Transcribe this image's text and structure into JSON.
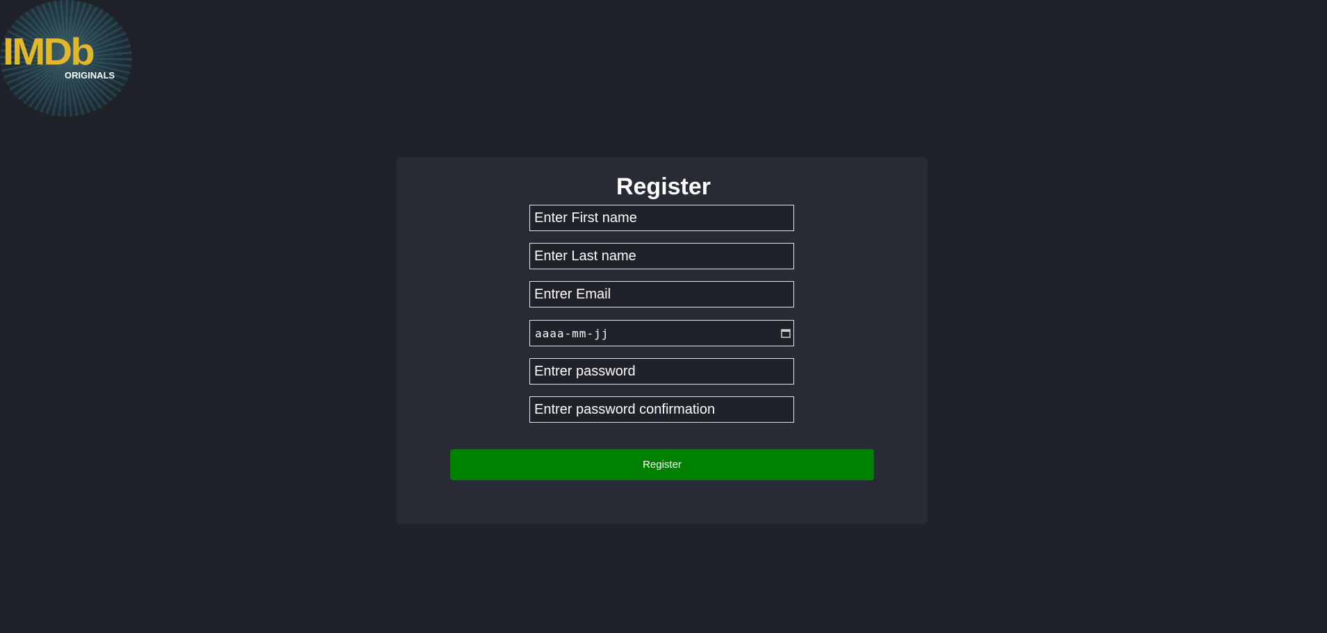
{
  "logo": {
    "main": "IMDb",
    "sub": "ORIGINALS"
  },
  "form": {
    "title": "Register",
    "first_name_placeholder": "Enter First name",
    "last_name_placeholder": "Enter Last name",
    "email_placeholder": "Entrer Email",
    "date_placeholder": "aaaa-mm-jj",
    "password_placeholder": "Entrer password",
    "password_confirm_placeholder": "Entrer password confirmation",
    "submit_label": "Register"
  },
  "colors": {
    "background": "#20222a",
    "card": "#282b34",
    "button": "#008000",
    "logo_accent": "#e2b72c"
  }
}
